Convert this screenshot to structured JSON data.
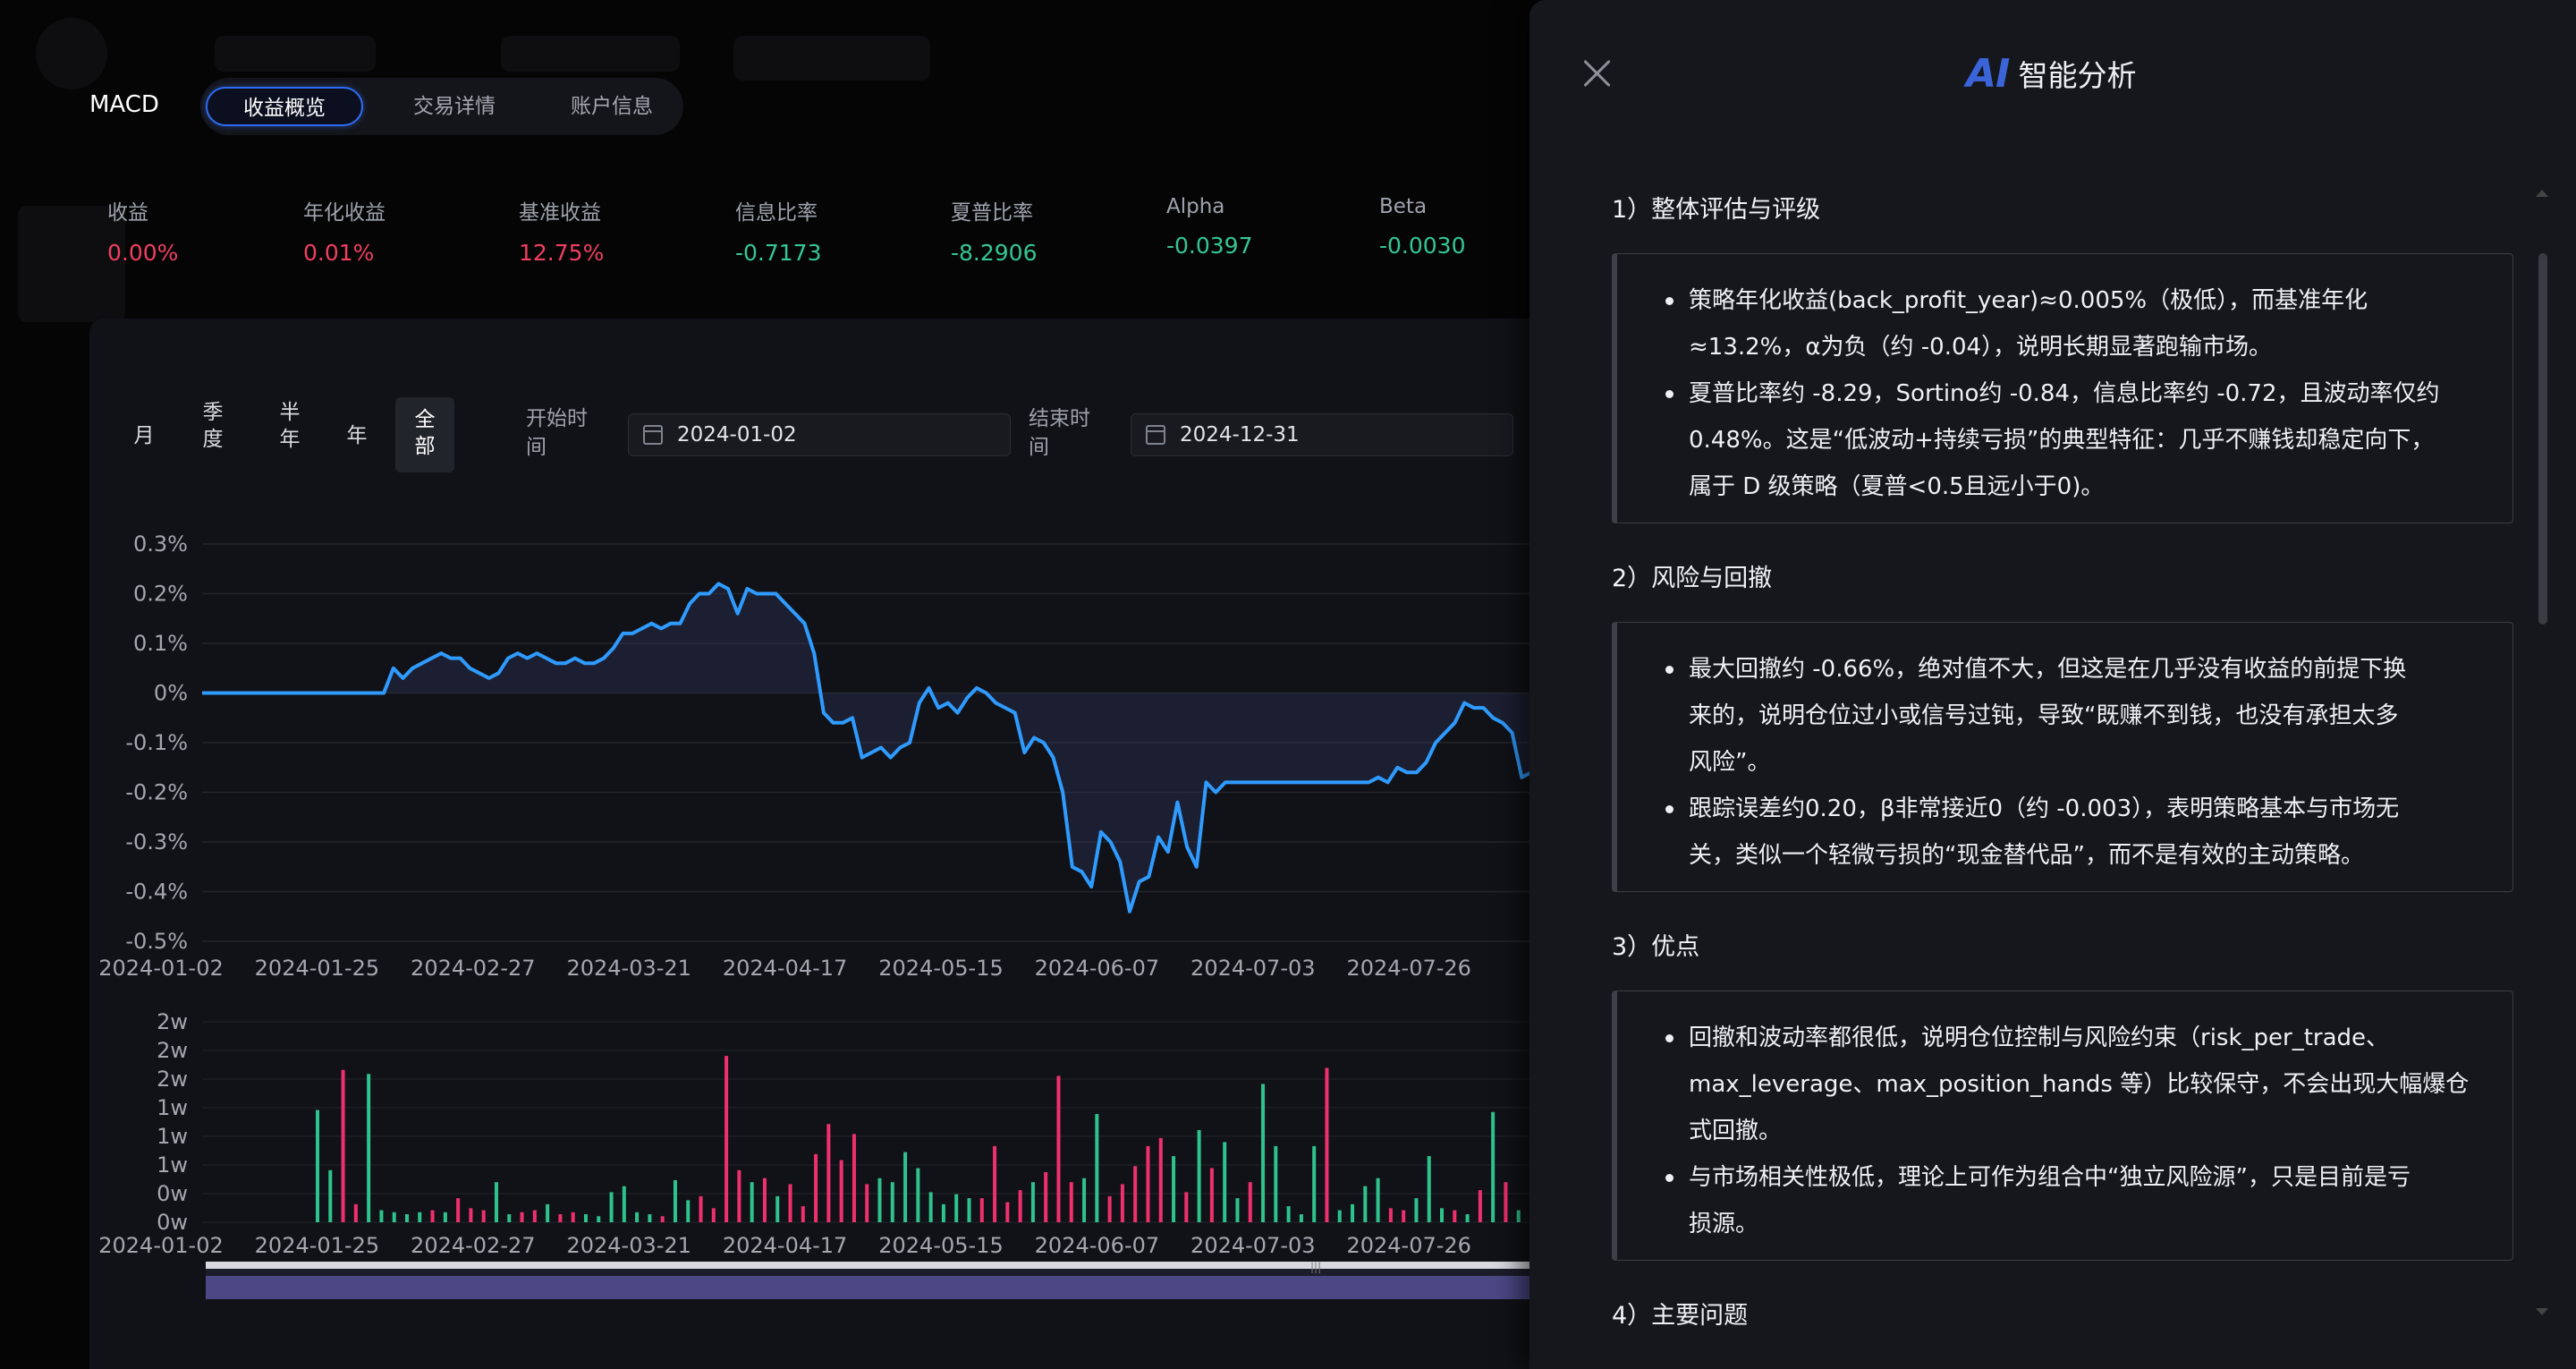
{
  "header": {
    "brand": "MACD",
    "tabs": [
      {
        "label": "收益概览",
        "active": true
      },
      {
        "label": "交易详情",
        "active": false
      },
      {
        "label": "账户信息",
        "active": false
      }
    ]
  },
  "metrics": [
    {
      "label": "收益",
      "value": "0.00%",
      "color": "red"
    },
    {
      "label": "年化收益",
      "value": "0.01%",
      "color": "red"
    },
    {
      "label": "基准收益",
      "value": "12.75%",
      "color": "red"
    },
    {
      "label": "信息比率",
      "value": "-0.7173",
      "color": "green"
    },
    {
      "label": "夏普比率",
      "value": "-8.2906",
      "color": "green"
    },
    {
      "label": "Alpha",
      "value": "-0.0397",
      "color": "green"
    },
    {
      "label": "Beta",
      "value": "-0.0030",
      "color": "green"
    }
  ],
  "filters": {
    "periods": [
      "月",
      "季度",
      "半年",
      "年",
      "全部"
    ],
    "active_period": "全部",
    "start_label": "开始时间",
    "start_value": "2024-01-02",
    "end_label": "结束时间",
    "end_value": "2024-12-31"
  },
  "chart_data": [
    {
      "type": "line",
      "y_tick_labels": [
        "0.3%",
        "0.2%",
        "0.1%",
        "0%",
        "-0.1%",
        "-0.2%",
        "-0.3%",
        "-0.4%",
        "-0.5%"
      ],
      "x_tick_labels": [
        "2024-01-02",
        "2024-01-25",
        "2024-02-27",
        "2024-03-21",
        "2024-04-17",
        "2024-05-15",
        "2024-06-07",
        "2024-07-03",
        "2024-07-26"
      ],
      "ylim": [
        -0.5,
        0.3
      ],
      "grid": true,
      "series": [
        {
          "color": "#2f9bff",
          "values": [
            0,
            0,
            0,
            0,
            0,
            0,
            0,
            0,
            0,
            0,
            0,
            0,
            0,
            0,
            0,
            0,
            0,
            0,
            0,
            0.0,
            0.05,
            0.03,
            0.05,
            0.06,
            0.07,
            0.08,
            0.07,
            0.07,
            0.05,
            0.04,
            0.03,
            0.04,
            0.07,
            0.08,
            0.07,
            0.08,
            0.07,
            0.06,
            0.06,
            0.07,
            0.06,
            0.06,
            0.07,
            0.09,
            0.12,
            0.12,
            0.13,
            0.14,
            0.13,
            0.14,
            0.14,
            0.18,
            0.2,
            0.2,
            0.22,
            0.21,
            0.16,
            0.21,
            0.2,
            0.2,
            0.2,
            0.18,
            0.16,
            0.14,
            0.08,
            -0.04,
            -0.06,
            -0.06,
            -0.05,
            -0.13,
            -0.12,
            -0.11,
            -0.13,
            -0.11,
            -0.1,
            -0.02,
            0.01,
            -0.03,
            -0.02,
            -0.04,
            -0.01,
            0.01,
            0.0,
            -0.02,
            -0.03,
            -0.04,
            -0.12,
            -0.09,
            -0.1,
            -0.13,
            -0.2,
            -0.35,
            -0.36,
            -0.39,
            -0.28,
            -0.3,
            -0.34,
            -0.44,
            -0.38,
            -0.37,
            -0.29,
            -0.32,
            -0.22,
            -0.31,
            -0.35,
            -0.18,
            -0.2,
            -0.18,
            -0.18,
            -0.18,
            -0.18,
            -0.18,
            -0.18,
            -0.18,
            -0.18,
            -0.18,
            -0.18,
            -0.18,
            -0.18,
            -0.18,
            -0.18,
            -0.18,
            -0.18,
            -0.17,
            -0.18,
            -0.15,
            -0.16,
            -0.16,
            -0.14,
            -0.1,
            -0.08,
            -0.06,
            -0.02,
            -0.03,
            -0.03,
            -0.05,
            -0.06,
            -0.08,
            -0.17,
            -0.16
          ]
        }
      ]
    },
    {
      "type": "bar",
      "y_tick_labels": [
        "2w",
        "2w",
        "2w",
        "1w",
        "1w",
        "1w",
        "0w",
        "0w"
      ],
      "x_tick_labels": [
        "2024-01-02",
        "2024-01-25",
        "2024-02-27",
        "2024-03-21",
        "2024-04-17",
        "2024-05-15",
        "2024-06-07",
        "2024-07-03",
        "2024-07-26"
      ],
      "ylim": [
        0,
        1
      ],
      "series": [
        {
          "name": "",
          "color": "#f0306e"
        },
        {
          "name": "",
          "color": "#2ec28d"
        }
      ],
      "bars": [
        [
          0.56,
          "g"
        ],
        [
          0.26,
          "g"
        ],
        [
          0.76,
          "r"
        ],
        [
          0.09,
          "r"
        ],
        [
          0.74,
          "g"
        ],
        [
          0.06,
          "g"
        ],
        [
          0.05,
          "g"
        ],
        [
          0.04,
          "g"
        ],
        [
          0.05,
          "g"
        ],
        [
          0.06,
          "r"
        ],
        [
          0.05,
          "g"
        ],
        [
          0.12,
          "r"
        ],
        [
          0.07,
          "r"
        ],
        [
          0.06,
          "r"
        ],
        [
          0.2,
          "g"
        ],
        [
          0.04,
          "g"
        ],
        [
          0.05,
          "r"
        ],
        [
          0.06,
          "r"
        ],
        [
          0.09,
          "g"
        ],
        [
          0.04,
          "r"
        ],
        [
          0.05,
          "r"
        ],
        [
          0.04,
          "g"
        ],
        [
          0.03,
          "g"
        ],
        [
          0.15,
          "g"
        ],
        [
          0.18,
          "g"
        ],
        [
          0.05,
          "g"
        ],
        [
          0.04,
          "g"
        ],
        [
          0.03,
          "r"
        ],
        [
          0.21,
          "g"
        ],
        [
          0.11,
          "g"
        ],
        [
          0.13,
          "r"
        ],
        [
          0.07,
          "r"
        ],
        [
          0.83,
          "r"
        ],
        [
          0.26,
          "r"
        ],
        [
          0.2,
          "g"
        ],
        [
          0.22,
          "r"
        ],
        [
          0.13,
          "g"
        ],
        [
          0.19,
          "r"
        ],
        [
          0.08,
          "r"
        ],
        [
          0.34,
          "r"
        ],
        [
          0.49,
          "r"
        ],
        [
          0.31,
          "r"
        ],
        [
          0.44,
          "r"
        ],
        [
          0.19,
          "r"
        ],
        [
          0.22,
          "g"
        ],
        [
          0.2,
          "g"
        ],
        [
          0.35,
          "g"
        ],
        [
          0.27,
          "g"
        ],
        [
          0.15,
          "g"
        ],
        [
          0.09,
          "g"
        ],
        [
          0.14,
          "g"
        ],
        [
          0.12,
          "g"
        ],
        [
          0.12,
          "r"
        ],
        [
          0.38,
          "r"
        ],
        [
          0.1,
          "r"
        ],
        [
          0.16,
          "r"
        ],
        [
          0.2,
          "g"
        ],
        [
          0.25,
          "r"
        ],
        [
          0.73,
          "r"
        ],
        [
          0.2,
          "r"
        ],
        [
          0.22,
          "g"
        ],
        [
          0.54,
          "g"
        ],
        [
          0.13,
          "r"
        ],
        [
          0.19,
          "r"
        ],
        [
          0.28,
          "r"
        ],
        [
          0.38,
          "r"
        ],
        [
          0.42,
          "r"
        ],
        [
          0.33,
          "g"
        ],
        [
          0.15,
          "r"
        ],
        [
          0.46,
          "g"
        ],
        [
          0.27,
          "r"
        ],
        [
          0.4,
          "g"
        ],
        [
          0.12,
          "g"
        ],
        [
          0.2,
          "r"
        ],
        [
          0.69,
          "g"
        ],
        [
          0.38,
          "g"
        ],
        [
          0.08,
          "g"
        ],
        [
          0.04,
          "g"
        ],
        [
          0.38,
          "g"
        ],
        [
          0.77,
          "r"
        ],
        [
          0.06,
          "g"
        ],
        [
          0.09,
          "g"
        ],
        [
          0.18,
          "g"
        ],
        [
          0.22,
          "g"
        ],
        [
          0.07,
          "r"
        ],
        [
          0.06,
          "r"
        ],
        [
          0.12,
          "g"
        ],
        [
          0.33,
          "g"
        ],
        [
          0.07,
          "g"
        ],
        [
          0.06,
          "r"
        ],
        [
          0.04,
          "g"
        ],
        [
          0.16,
          "r"
        ],
        [
          0.55,
          "g"
        ],
        [
          0.2,
          "r"
        ],
        [
          0.06,
          "g"
        ],
        [
          0.09,
          "g"
        ]
      ]
    }
  ],
  "ai_panel": {
    "logo": "AI",
    "title": "智能分析",
    "sections": [
      {
        "heading": "1）整体评估与评级",
        "lines": [
          [
            "策略年化收益(back_profit_year)≈0.005%（极低），而基准年化",
            "≈13.2%，α为负（约 -0.04），说明长期显著跑输市场。"
          ],
          [
            "夏普比率约 -8.29，Sortino约 -0.84，信息比率约 -0.72，且波动率仅约",
            "0.48%。这是“低波动+持续亏损”的典型特征：几乎不赚钱却稳定向下，",
            "属于 D 级策略（夏普<0.5且远小于0)。"
          ]
        ]
      },
      {
        "heading": "2）风险与回撤",
        "lines": [
          [
            "最大回撤约 -0.66%，绝对值不大，但这是在几乎没有收益的前提下换",
            "来的，说明仓位过小或信号过钝，导致“既赚不到钱，也没有承担太多",
            "风险”。"
          ],
          [
            "跟踪误差约0.20，β非常接近0（约 -0.003），表明策略基本与市场无",
            "关，类似一个轻微亏损的“现金替代品”，而不是有效的主动策略。"
          ]
        ]
      },
      {
        "heading": "3）优点",
        "lines": [
          [
            "回撤和波动率都很低，说明仓位控制与风险约束（risk_per_trade、",
            "max_leverage、max_position_hands 等）比较保守，不会出现大幅爆仓",
            "式回撤。"
          ],
          [
            "与市场相关性极低，理论上可作为组合中“独立风险源”，只是目前是亏",
            "损源。"
          ]
        ]
      },
      {
        "heading": "4）主要问题",
        "lines": []
      }
    ]
  }
}
